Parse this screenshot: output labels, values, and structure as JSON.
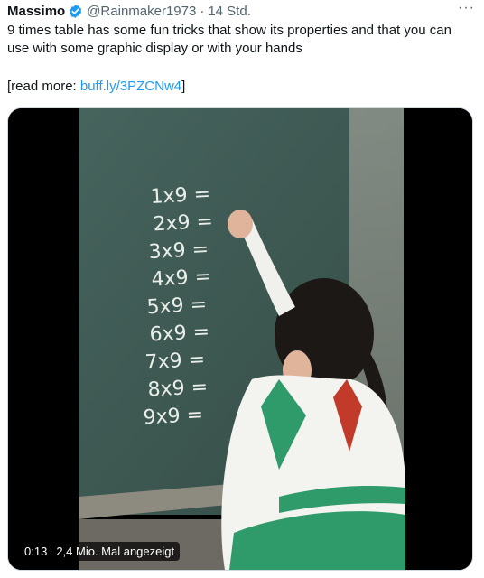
{
  "tweet": {
    "author_name": "Massimo",
    "handle": "@Rainmaker1973",
    "separator": "·",
    "time": "14 Std.",
    "more_label": "···",
    "text": "9 times table has some fun tricks that show its properties and that you can use with some graphic display or with your hands",
    "read_more_prefix": "[read more: ",
    "link_text": "buff.ly/3PZCNw4",
    "read_more_suffix": "]"
  },
  "video": {
    "elapsed": "0:13",
    "views": "2,4 Mio. Mal angezeigt",
    "chalkboard_lines": [
      "1x9 =",
      "2x9 =",
      "3x9 =",
      "4x9 =",
      "5x9 =",
      "6x9 =",
      "7x9 =",
      "8x9 =",
      "9x9 ="
    ]
  },
  "colors": {
    "verified_blue": "#1d9bf0",
    "link_blue": "#1d9bf0",
    "chalkboard": "#3f5a54",
    "uniform_green": "#2f9a6a"
  }
}
